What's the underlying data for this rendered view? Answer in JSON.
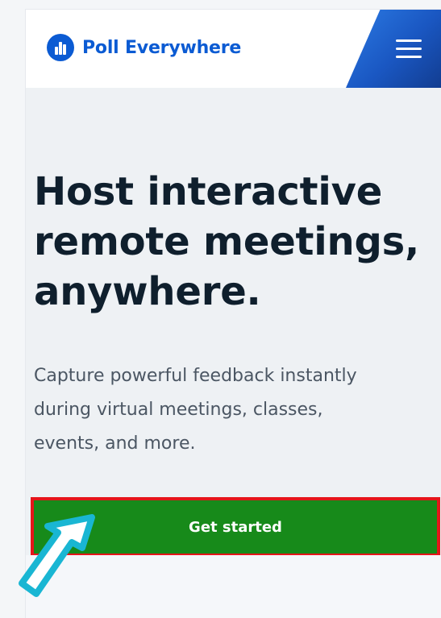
{
  "header": {
    "brand_name": "Poll Everywhere",
    "menu_icon": "hamburger-menu-icon",
    "brand_logo_icon": "poll-everywhere-logo-icon"
  },
  "hero": {
    "title_lines": [
      "Host interactive",
      "remote meetings,",
      "anywhere."
    ],
    "subtitle_lines": [
      "Capture powerful feedback instantly",
      "during virtual meetings, classes,",
      "events, and more."
    ],
    "cta_label": "Get started"
  },
  "overlay": {
    "pointer_icon": "cursor-arrow-icon",
    "highlight_color": "#e5151a",
    "pointer_color": "#19b6d3"
  },
  "colors": {
    "brand_blue": "#0b5bd3",
    "cta_green": "#178a1a",
    "title_text": "#0f1f2d",
    "body_text": "#4b5663"
  }
}
